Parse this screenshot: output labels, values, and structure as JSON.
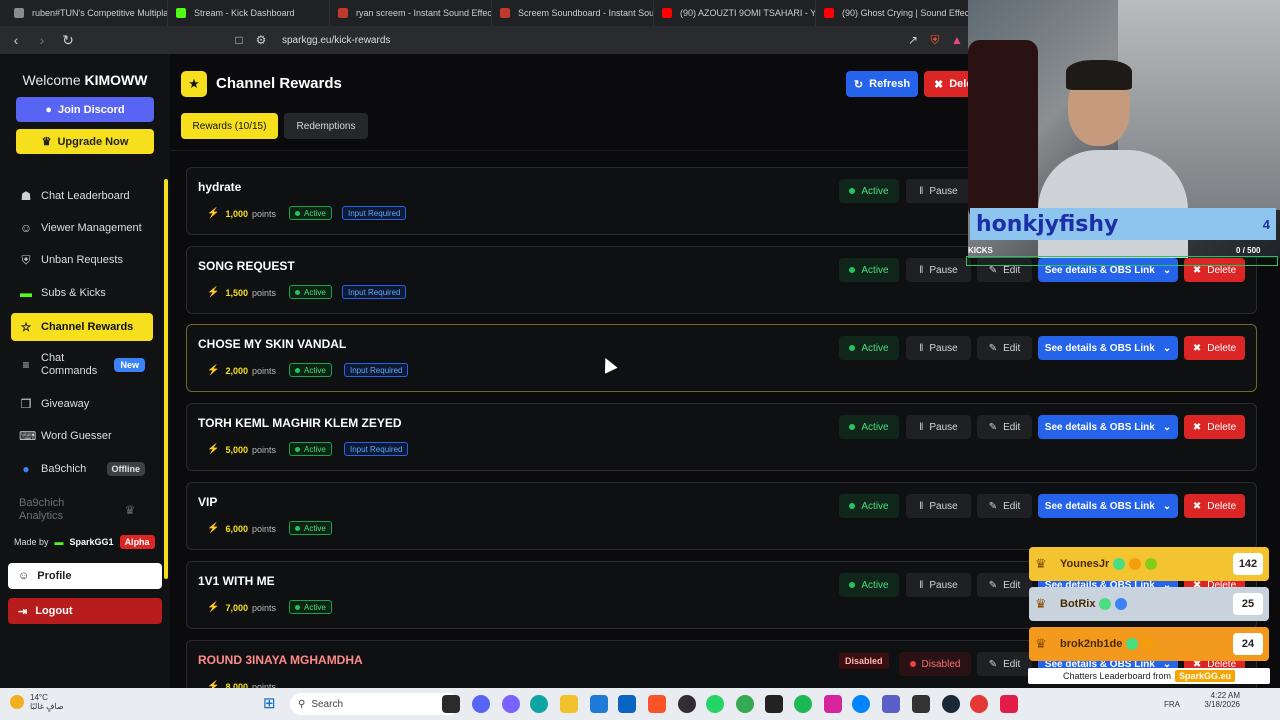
{
  "browser": {
    "tabs": [
      {
        "title": "ruben#TUN's Competitive Multiplay",
        "color": "#8a8a8a"
      },
      {
        "title": "Stream - Kick Dashboard",
        "color": "#53fc18"
      },
      {
        "title": "ryan screem - Instant Sound Effect B",
        "color": "#c0392b"
      },
      {
        "title": "Screem Soundboard - Instant Sound",
        "color": "#c0392b"
      },
      {
        "title": "(90) AZOUZTI 9OMI TSAHARI - YouT",
        "color": "#ff0000"
      },
      {
        "title": "(90) Ghost Crying | Sound Effect #sc",
        "color": "#ff0000"
      }
    ],
    "url": "sparkgg.eu/kick-rewards"
  },
  "sidebar": {
    "welcome_prefix": "Welcome",
    "username": "KIMOWW",
    "join_discord": "Join Discord",
    "upgrade_now": "Upgrade Now",
    "nav": [
      {
        "label": "Chat Leaderboard",
        "icon": "trophy-icon"
      },
      {
        "label": "Viewer Management",
        "icon": "users-icon"
      },
      {
        "label": "Unban Requests",
        "icon": "shield-icon"
      },
      {
        "label": "Subs & Kicks",
        "icon": "kick-icon"
      },
      {
        "label": "Channel Rewards",
        "icon": "award-icon"
      },
      {
        "label": "Chat Commands",
        "icon": "terminal-icon",
        "badge": "New"
      },
      {
        "label": "Giveaway",
        "icon": "gift-icon"
      },
      {
        "label": "Word Guesser",
        "icon": "keyboard-icon"
      },
      {
        "label": "Ba9chich",
        "icon": "ba9chich-icon",
        "badge": "Offline"
      },
      {
        "label": "Ba9chich Analytics",
        "icon": "crown-icon"
      }
    ],
    "made_by": "Made by",
    "brand": "SparkGG1",
    "brand_tag": "Alpha",
    "profile": "Profile",
    "logout": "Logout"
  },
  "main": {
    "title": "Channel Rewards",
    "refresh": "Refresh",
    "delete_all": "Dele",
    "tab_rewards": "Rewards (10/15)",
    "tab_redemptions": "Redemptions",
    "points_word": "points",
    "labels": {
      "active": "Active",
      "input_required": "Input Required",
      "pause": "Pause",
      "edit": "Edit",
      "obs": "See details & OBS Link",
      "delete": "Delete",
      "disabled": "Disabled"
    },
    "rewards": [
      {
        "name": "hydrate",
        "cost": "1,000",
        "input": true,
        "status": "active"
      },
      {
        "name": "SONG REQUEST",
        "cost": "1,500",
        "input": true,
        "status": "active"
      },
      {
        "name": "CHOSE MY SKIN VANDAL",
        "cost": "2,000",
        "input": true,
        "status": "active"
      },
      {
        "name": "TORH KEML MAGHIR KLEM ZEYED",
        "cost": "5,000",
        "input": true,
        "status": "active"
      },
      {
        "name": "VIP",
        "cost": "6,000",
        "input": false,
        "status": "active"
      },
      {
        "name": "1V1 WITH ME",
        "cost": "7,000",
        "input": false,
        "status": "active"
      },
      {
        "name": "ROUND 3INAYA MGHAMDHA",
        "cost": "8,000",
        "input": false,
        "status": "disabled"
      }
    ]
  },
  "overlay": {
    "kick_user": "honkjyfishy",
    "kick_count": "4",
    "kicks_label": "KICKS",
    "kicks_progress": "0 / 500",
    "leaderboard": [
      {
        "name": "YounesJr",
        "count": "142",
        "bg": "#f4c430"
      },
      {
        "name": "BotRix",
        "count": "25",
        "bg": "#c9d3dd"
      },
      {
        "name": "brok2nb1de",
        "count": "24",
        "bg": "#f39a1e"
      }
    ],
    "leaderboard_footer": "Chatters Leaderboard from",
    "leaderboard_brand": "SparkGG.eu"
  },
  "taskbar": {
    "temp": "14°C",
    "weather_desc": "صافٍ غالبًا",
    "search": "Search",
    "lang": "FRA",
    "time": "4:22 AM",
    "date": "3/18/2026"
  }
}
